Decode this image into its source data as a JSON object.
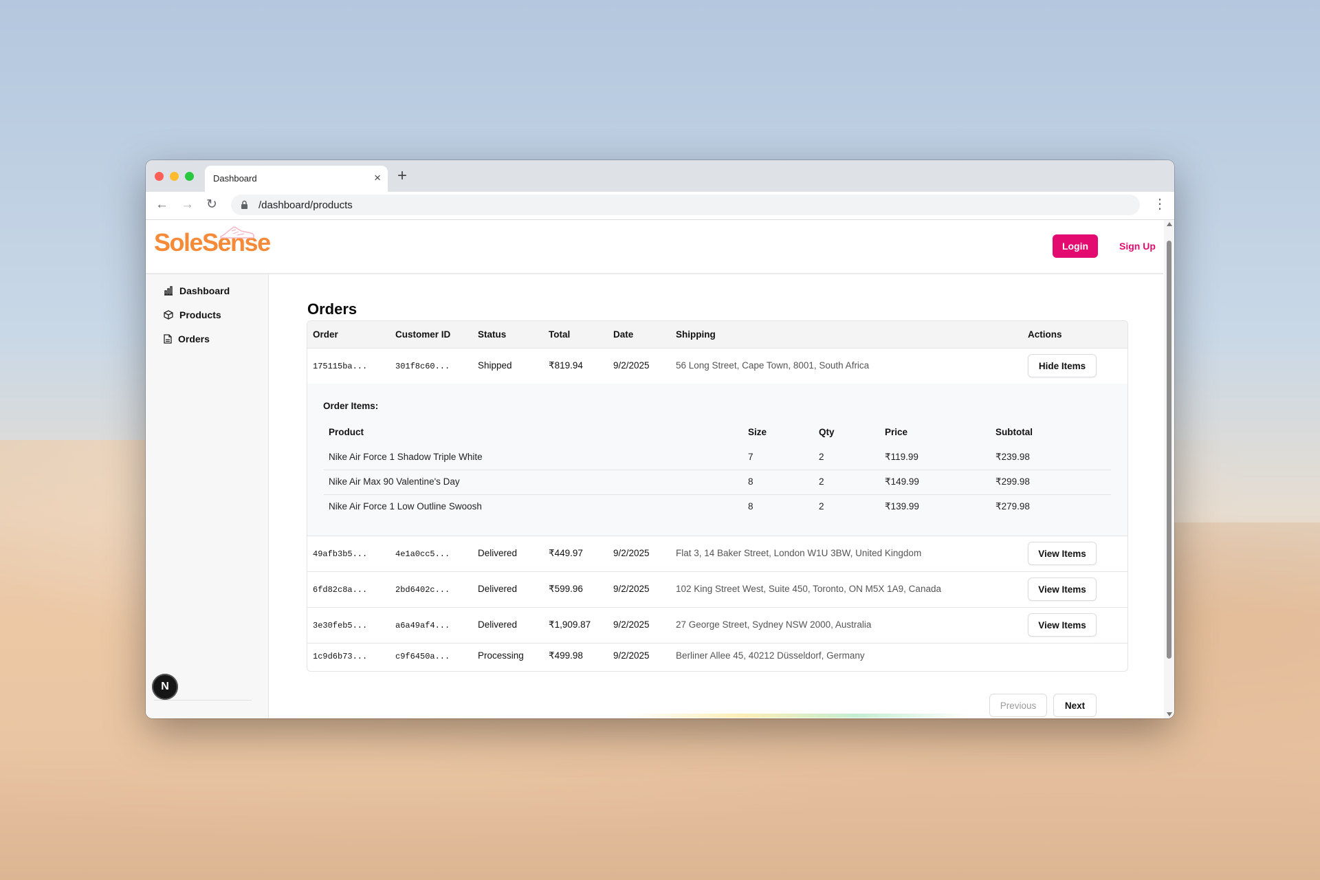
{
  "browser": {
    "tab_title": "Dashboard",
    "tab_close": "×",
    "new_tab": "+",
    "url": "/dashboard/products",
    "back": "←",
    "forward": "→",
    "reload": "↻",
    "menu": "⋮"
  },
  "header": {
    "logo": "SoleSense",
    "login_label": "Login",
    "signup_label": "Sign Up",
    "accent_color": "#e30b6f",
    "logo_color": "#f58a38"
  },
  "sidebar": {
    "items": [
      {
        "label": "Dashboard",
        "icon": "bar-chart-icon"
      },
      {
        "label": "Products",
        "icon": "package-icon"
      },
      {
        "label": "Orders",
        "icon": "document-icon"
      }
    ],
    "badge": "N"
  },
  "main": {
    "title": "Orders",
    "columns": [
      "Order",
      "Customer ID",
      "Status",
      "Total",
      "Date",
      "Shipping",
      "Actions"
    ],
    "orders": [
      {
        "order": "175115ba...",
        "customer": "301f8c60...",
        "status": "Shipped",
        "total": "₹819.94",
        "date": "9/2/2025",
        "shipping": "56 Long Street, Cape Town, 8001, South Africa",
        "action": "Hide Items"
      },
      {
        "order": "49afb3b5...",
        "customer": "4e1a0cc5...",
        "status": "Delivered",
        "total": "₹449.97",
        "date": "9/2/2025",
        "shipping": "Flat 3, 14 Baker Street, London W1U 3BW, United Kingdom",
        "action": "View Items"
      },
      {
        "order": "6fd82c8a...",
        "customer": "2bd6402c...",
        "status": "Delivered",
        "total": "₹599.96",
        "date": "9/2/2025",
        "shipping": "102 King Street West, Suite 450, Toronto, ON M5X 1A9, Canada",
        "action": "View Items"
      },
      {
        "order": "3e30feb5...",
        "customer": "a6a49af4...",
        "status": "Delivered",
        "total": "₹1,909.87",
        "date": "9/2/2025",
        "shipping": "27 George Street, Sydney NSW 2000, Australia",
        "action": "View Items"
      },
      {
        "order": "1c9d6b73...",
        "customer": "c9f6450a...",
        "status": "Processing",
        "total": "₹499.98",
        "date": "9/2/2025",
        "shipping": "Berliner Allee 45, 40212 Düsseldorf, Germany",
        "action": ""
      }
    ],
    "order_items": {
      "title": "Order Items:",
      "columns": [
        "Product",
        "Size",
        "Qty",
        "Price",
        "Subtotal"
      ],
      "rows": [
        {
          "product": "Nike Air Force 1 Shadow Triple White",
          "size": "7",
          "qty": "2",
          "price": "₹119.99",
          "subtotal": "₹239.98"
        },
        {
          "product": "Nike Air Max 90 Valentine's Day",
          "size": "8",
          "qty": "2",
          "price": "₹149.99",
          "subtotal": "₹299.98"
        },
        {
          "product": "Nike Air Force 1 Low Outline Swoosh",
          "size": "8",
          "qty": "2",
          "price": "₹139.99",
          "subtotal": "₹279.98"
        }
      ]
    },
    "pagination": {
      "previous": "Previous",
      "next": "Next"
    }
  }
}
